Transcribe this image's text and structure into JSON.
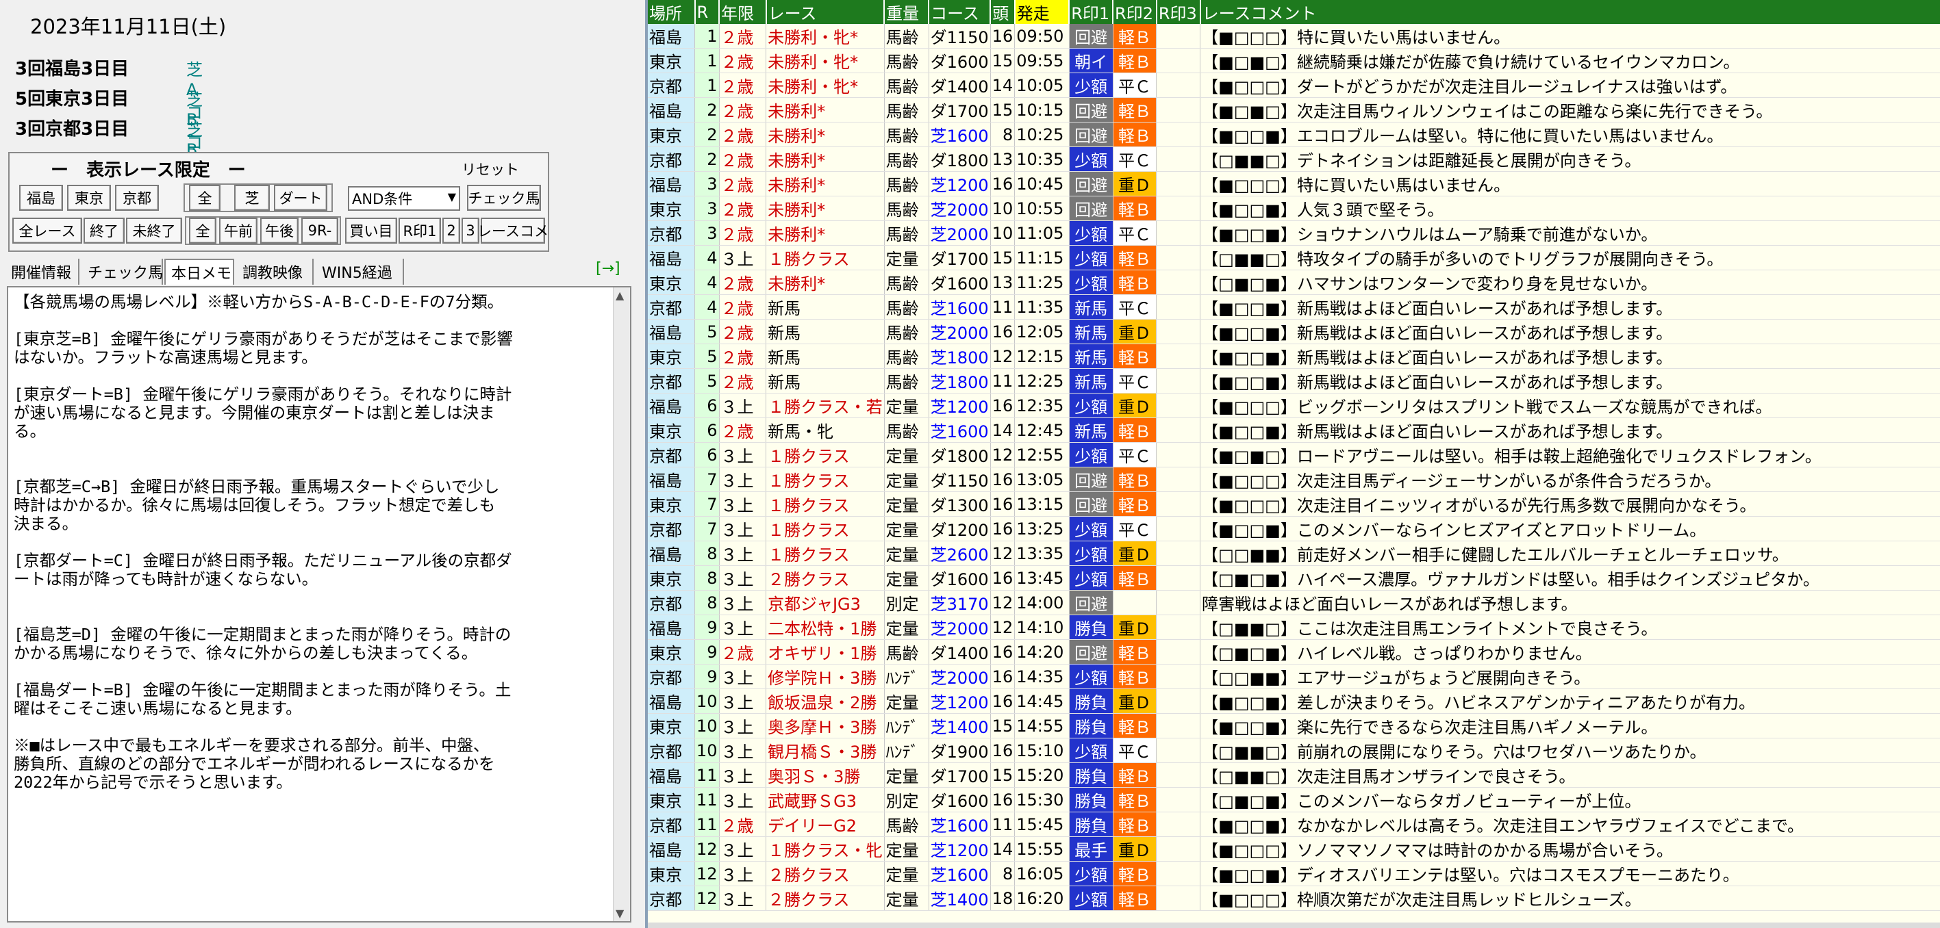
{
  "left": {
    "date": "2023年11月11日(土)",
    "venues": [
      {
        "name": "3回福島3日目",
        "course": "芝 Aコース"
      },
      {
        "name": "5回東京3日目",
        "course": "芝 Bコース"
      },
      {
        "name": "3回京都3日目",
        "course": "芝 Bコース"
      }
    ],
    "filter": {
      "title": "ー　表示レース限定　ー",
      "reset": "リセット",
      "buttons": {
        "fukushima": "福島",
        "tokyo": "東京",
        "kyoto": "京都",
        "all": "全",
        "turf": "芝",
        "dirt": "ダート",
        "check": "チェック馬",
        "all_races": "全レース",
        "finished": "終了",
        "unfinished": "未終了",
        "all2": "全",
        "am": "午前",
        "pm": "午後",
        "r9": "9R-",
        "kaime": "買い目",
        "mark1": "R印1",
        "mark2": "2",
        "mark3": "3",
        "comment": "レースコメ"
      },
      "condition": "AND条件"
    },
    "tabs": [
      "開催情報",
      "チェック馬",
      "本日メモ",
      "調教映像",
      "WIN5経過"
    ],
    "expand": "[→]",
    "memo": "【各競馬場の馬場レベル】※軽い方からS-A-B-C-D-E-Fの7分類。\n\n[東京芝=B] 金曜午後にゲリラ豪雨がありそうだが芝はそこまで影響\nはないか。フラットな高速馬場と見ます。\n\n[東京ダート=B] 金曜午後にゲリラ豪雨がありそう。それなりに時計\nが速い馬場になると見ます。今開催の東京ダートは割と差しは決ま\nる。\n\n\n[京都芝=C→B] 金曜日が終日雨予報。重馬場スタートぐらいで少し\n時計はかかるか。徐々に馬場は回復しそう。フラット想定で差しも\n決まる。\n\n[京都ダート=C] 金曜日が終日雨予報。ただリニューアル後の京都ダ\nートは雨が降っても時計が速くならない。\n\n\n[福島芝=D] 金曜の午後に一定期間まとまった雨が降りそう。時計の\nかかる馬場になりそうで、徐々に外からの差しも決まってくる。\n\n[福島ダート=B] 金曜の午後に一定期間まとまった雨が降りそう。土\n曜はそこそこ速い馬場になると見ます。\n\n※■はレース中で最もエネルギーを要求される部分。前半、中盤、\n勝負所、直線のどの部分でエネルギーが問われるレースになるかを\n2022年から記号で示そうと思います。"
  },
  "table": {
    "headers": [
      "場所",
      "R",
      "年限",
      "レース",
      "重量",
      "コース",
      "頭",
      "発走",
      "R印1",
      "R印2",
      "R印3",
      "レースコメント"
    ],
    "rows": [
      [
        "福島",
        "1",
        "２歳",
        "未勝利・牝*",
        "馬齢",
        "ダ1150",
        "16",
        "09:50",
        "回避",
        "軽Ｂ",
        "",
        "【■□□□】特に買いたい馬はいません。"
      ],
      [
        "東京",
        "1",
        "２歳",
        "未勝利・牝*",
        "馬齢",
        "ダ1600",
        "15",
        "09:55",
        "朝イ",
        "軽Ｂ",
        "",
        "【■□■□】継続騎乗は嫌だが佐藤で負け続けているセイウンマカロン。"
      ],
      [
        "京都",
        "1",
        "２歳",
        "未勝利・牝*",
        "馬齢",
        "ダ1400",
        "14",
        "10:05",
        "少額",
        "平Ｃ",
        "",
        "【■□□□】ダートがどうかだが次走注目ルージュレイナスは強いはず。"
      ],
      [
        "福島",
        "2",
        "２歳",
        "未勝利*",
        "馬齢",
        "ダ1700",
        "15",
        "10:15",
        "回避",
        "軽Ｂ",
        "",
        "【■□■□】次走注目馬ウィルソンウェイはこの距離なら楽に先行できそう。"
      ],
      [
        "東京",
        "2",
        "２歳",
        "未勝利*",
        "馬齢",
        "芝1600",
        "8",
        "10:25",
        "回避",
        "軽Ｂ",
        "",
        "【■□□■】エコロブルームは堅い。特に他に買いたい馬はいません。"
      ],
      [
        "京都",
        "2",
        "２歳",
        "未勝利*",
        "馬齢",
        "ダ1800",
        "13",
        "10:35",
        "少額",
        "平Ｃ",
        "",
        "【□■■□】デトネイションは距離延長と展開が向きそう。"
      ],
      [
        "福島",
        "3",
        "２歳",
        "未勝利*",
        "馬齢",
        "芝1200",
        "16",
        "10:45",
        "回避",
        "重Ｄ",
        "",
        "【■□□□】特に買いたい馬はいません。"
      ],
      [
        "東京",
        "3",
        "２歳",
        "未勝利*",
        "馬齢",
        "芝2000",
        "10",
        "10:55",
        "回避",
        "軽Ｂ",
        "",
        "【■□□■】人気３頭で堅そう。"
      ],
      [
        "京都",
        "3",
        "２歳",
        "未勝利*",
        "馬齢",
        "芝2000",
        "10",
        "11:05",
        "少額",
        "平Ｃ",
        "",
        "【■□□■】ショウナンハウルはムーア騎乗で前進がないか。"
      ],
      [
        "福島",
        "4",
        "３上",
        "１勝クラス",
        "定量",
        "ダ1700",
        "15",
        "11:15",
        "少額",
        "軽Ｂ",
        "",
        "【□■■□】特攻タイプの騎手が多いのでトリグラフが展開向きそう。"
      ],
      [
        "東京",
        "4",
        "２歳",
        "未勝利*",
        "馬齢",
        "ダ1600",
        "13",
        "11:25",
        "少額",
        "軽Ｂ",
        "",
        "【□■□■】ハマサンはワンターンで変わり身を見せないか。"
      ],
      [
        "京都",
        "4",
        "２歳",
        "新馬",
        "馬齢",
        "芝1600",
        "11",
        "11:35",
        "新馬",
        "平Ｃ",
        "",
        "【■□□■】新馬戦はよほど面白いレースがあれば予想します。"
      ],
      [
        "福島",
        "5",
        "２歳",
        "新馬",
        "馬齢",
        "芝2000",
        "16",
        "12:05",
        "新馬",
        "重Ｄ",
        "",
        "【■□□■】新馬戦はよほど面白いレースがあれば予想します。"
      ],
      [
        "東京",
        "5",
        "２歳",
        "新馬",
        "馬齢",
        "芝1800",
        "12",
        "12:15",
        "新馬",
        "軽Ｂ",
        "",
        "【■□□■】新馬戦はよほど面白いレースがあれば予想します。"
      ],
      [
        "京都",
        "5",
        "２歳",
        "新馬",
        "馬齢",
        "芝1800",
        "11",
        "12:25",
        "新馬",
        "平Ｃ",
        "",
        "【■□□■】新馬戦はよほど面白いレースがあれば予想します。"
      ],
      [
        "福島",
        "6",
        "３上",
        "１勝クラス・若",
        "定量",
        "芝1200",
        "16",
        "12:35",
        "少額",
        "重Ｄ",
        "",
        "【■□□□】ビッグボーンリタはスプリント戦でスムーズな競馬ができれば。"
      ],
      [
        "東京",
        "6",
        "２歳",
        "新馬・牝",
        "馬齢",
        "芝1600",
        "14",
        "12:45",
        "新馬",
        "軽Ｂ",
        "",
        "【■□□■】新馬戦はよほど面白いレースがあれば予想します。"
      ],
      [
        "京都",
        "6",
        "３上",
        "１勝クラス",
        "定量",
        "ダ1800",
        "12",
        "12:55",
        "少額",
        "平Ｃ",
        "",
        "【■□■□】ロードアヴニールは堅い。相手は鞍上超絶強化でリュクスドレフォン。"
      ],
      [
        "福島",
        "7",
        "３上",
        "１勝クラス",
        "定量",
        "ダ1150",
        "16",
        "13:05",
        "回避",
        "軽Ｂ",
        "",
        "【■□□□】次走注目馬ディージェーサンがいるが条件合うだろうか。"
      ],
      [
        "東京",
        "7",
        "３上",
        "１勝クラス",
        "定量",
        "ダ1300",
        "16",
        "13:15",
        "回避",
        "軽Ｂ",
        "",
        "【■□□□】次走注目イニッツィオがいるが先行馬多数で展開向かなそう。"
      ],
      [
        "京都",
        "7",
        "３上",
        "１勝クラス",
        "定量",
        "ダ1200",
        "16",
        "13:25",
        "少額",
        "平Ｃ",
        "",
        "【■□□■】このメンバーならインヒズアイズとアロットドリーム。"
      ],
      [
        "福島",
        "8",
        "３上",
        "１勝クラス",
        "定量",
        "芝2600",
        "12",
        "13:35",
        "少額",
        "重Ｄ",
        "",
        "【□□■■】前走好メンバー相手に健闘したエルバルーチェとルーチェロッサ。"
      ],
      [
        "東京",
        "8",
        "３上",
        "２勝クラス",
        "定量",
        "ダ1600",
        "16",
        "13:45",
        "少額",
        "軽Ｂ",
        "",
        "【□■□■】ハイペース濃厚。ヴァナルガンドは堅い。相手はクインズジュピタか。"
      ],
      [
        "京都",
        "8",
        "３上",
        "京都ジャJG3",
        "別定",
        "芝3170",
        "12",
        "14:00",
        "回避",
        "",
        "",
        "障害戦はよほど面白いレースがあれば予想します。"
      ],
      [
        "福島",
        "9",
        "３上",
        "二本松特・1勝",
        "定量",
        "芝2000",
        "12",
        "14:10",
        "勝負",
        "重Ｄ",
        "",
        "【□■■□】ここは次走注目馬エンライトメントで良さそう。"
      ],
      [
        "東京",
        "9",
        "２歳",
        "オキザリ・1勝",
        "馬齢",
        "ダ1400",
        "16",
        "14:20",
        "回避",
        "軽Ｂ",
        "",
        "【□■□■】ハイレベル戦。さっぱりわかりません。"
      ],
      [
        "京都",
        "9",
        "３上",
        "修学院Ｈ・3勝",
        "ﾊﾝﾃﾞ",
        "芝2000",
        "16",
        "14:35",
        "少額",
        "軽Ｂ",
        "",
        "【□□■■】エアサージュがちょうど展開向きそう。"
      ],
      [
        "福島",
        "10",
        "３上",
        "飯坂温泉・2勝",
        "定量",
        "芝1200",
        "16",
        "14:45",
        "勝負",
        "重Ｄ",
        "",
        "【■□□■】差しが決まりそう。ハビネスアゲンかティニアあたりが有力。"
      ],
      [
        "東京",
        "10",
        "３上",
        "奥多摩Ｈ・3勝",
        "ﾊﾝﾃﾞ",
        "芝1400",
        "15",
        "14:55",
        "勝負",
        "軽Ｂ",
        "",
        "【■□□■】楽に先行できるなら次走注目馬ハギノメーテル。"
      ],
      [
        "京都",
        "10",
        "３上",
        "観月橋Ｓ・3勝",
        "ﾊﾝﾃﾞ",
        "ダ1900",
        "16",
        "15:10",
        "少額",
        "平Ｃ",
        "",
        "【□■■□】前崩れの展開になりそう。穴はワセダハーツあたりか。"
      ],
      [
        "福島",
        "11",
        "３上",
        "奥羽Ｓ・3勝",
        "定量",
        "ダ1700",
        "15",
        "15:20",
        "勝負",
        "軽Ｂ",
        "",
        "【□■■□】次走注目馬オンザラインで良さそう。"
      ],
      [
        "東京",
        "11",
        "３上",
        "武蔵野ＳG3",
        "別定",
        "ダ1600",
        "16",
        "15:30",
        "勝負",
        "軽Ｂ",
        "",
        "【□■□■】このメンバーならタガノビューティーが上位。"
      ],
      [
        "京都",
        "11",
        "２歳",
        "デイリーG2",
        "馬齢",
        "芝1600",
        "11",
        "15:45",
        "勝負",
        "軽Ｂ",
        "",
        "【■□□■】なかなかレベルは高そう。次走注目エンヤラヴフェイスでどこまで。"
      ],
      [
        "福島",
        "12",
        "３上",
        "１勝クラス・牝",
        "定量",
        "芝1200",
        "14",
        "15:55",
        "最手",
        "重Ｄ",
        "",
        "【■□□□】ソノママソノママは時計のかかる馬場が合いそう。"
      ],
      [
        "東京",
        "12",
        "３上",
        "２勝クラス",
        "定量",
        "芝1600",
        "8",
        "16:05",
        "少額",
        "軽Ｂ",
        "",
        "【■□□■】ディオスバリエンテは堅い。穴はコスモスプモーニあたり。"
      ],
      [
        "京都",
        "12",
        "３上",
        "２勝クラス",
        "定量",
        "芝1400",
        "18",
        "16:20",
        "少額",
        "軽Ｂ",
        "",
        "【■□□□】枠順次第だが次走注目馬レッドヒルシューズ。"
      ]
    ],
    "colors": {
      "header_bg": "#1e7a1e",
      "start_header_bg": "#ffff00",
      "red_text": "#d00000",
      "blue_text": "#0000ff",
      "kei_bg": "#ff6a00",
      "juu_bg": "#ffc000",
      "mark_blue_bg": "#2233cc",
      "kaihi_bg": "#777777"
    }
  }
}
